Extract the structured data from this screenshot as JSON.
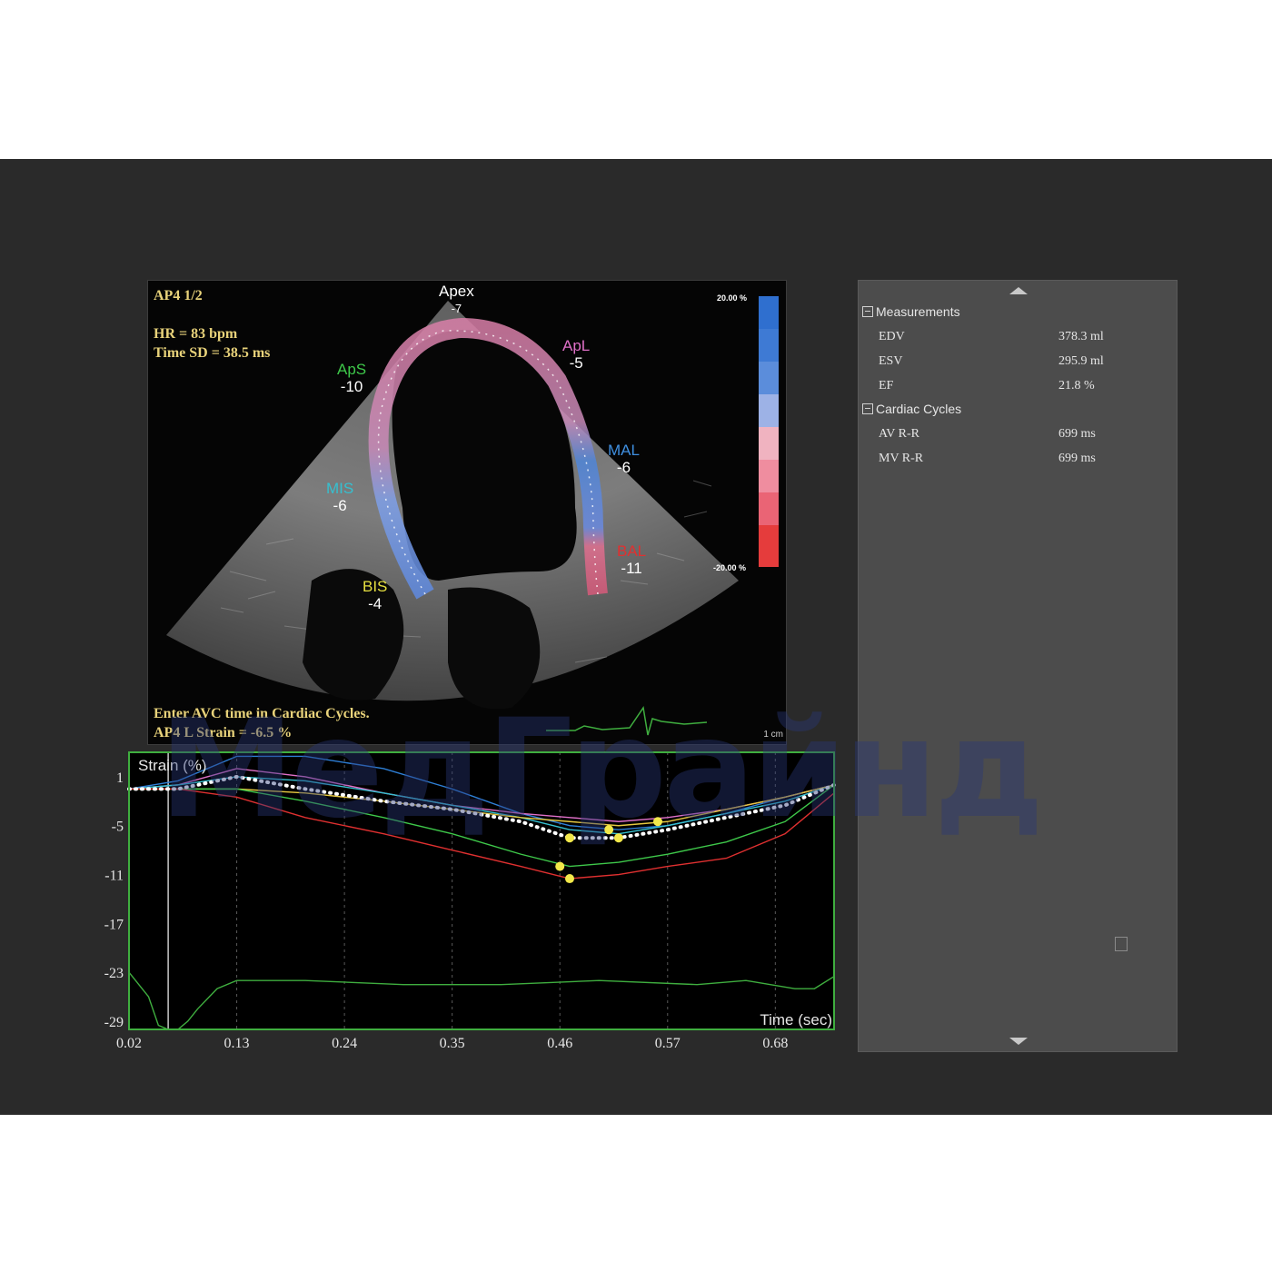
{
  "echo": {
    "view_label": "AP4  1/2",
    "hr": "HR = 83 bpm",
    "time_sd": "Time SD = 38.5 ms",
    "avc_prompt": "Enter AVC time in Cardiac Cycles.",
    "strain_result": "AP4 L Strain = -6.5 %",
    "colorbar_top": "20.00 %",
    "colorbar_bottom": "-20.00 %",
    "scale_label": "1 cm",
    "segments": [
      {
        "name": "Apex",
        "value": "-7",
        "color": "#ffffff"
      },
      {
        "name": "ApL",
        "value": "-5",
        "color": "#e070c8"
      },
      {
        "name": "ApS",
        "value": "-10",
        "color": "#3ec84a"
      },
      {
        "name": "MAL",
        "value": "-6",
        "color": "#3f8fe0"
      },
      {
        "name": "MIS",
        "value": "-6",
        "color": "#35c0d0"
      },
      {
        "name": "BAL",
        "value": "-11",
        "color": "#e03030"
      },
      {
        "name": "BIS",
        "value": "-4",
        "color": "#e6e040"
      }
    ]
  },
  "watermark": "МедГрайнд",
  "measurements": {
    "group1_title": "Measurements",
    "group1_rows": [
      {
        "label": "EDV",
        "value": "378.3 ml"
      },
      {
        "label": "ESV",
        "value": "295.9 ml"
      },
      {
        "label": "EF",
        "value": "21.8 %"
      }
    ],
    "group2_title": "Cardiac Cycles",
    "group2_rows": [
      {
        "label": "AV R-R",
        "value": "699 ms"
      },
      {
        "label": "MV R-R",
        "value": "699 ms"
      }
    ]
  },
  "chart_data": {
    "type": "line",
    "ylabel": "Strain (%)",
    "xlabel": "Time (sec)",
    "x_ticks": [
      "0.02",
      "0.13",
      "0.24",
      "0.35",
      "0.46",
      "0.57",
      "0.68"
    ],
    "y_ticks": [
      "1",
      "-5",
      "-11",
      "-17",
      "-23",
      "-29"
    ],
    "xlim": [
      0.02,
      0.74
    ],
    "ylim": [
      -30,
      4
    ],
    "grid": true,
    "frame_color": "#3fae3f",
    "marker_line_x": 0.06,
    "x": [
      0.02,
      0.07,
      0.13,
      0.2,
      0.28,
      0.35,
      0.42,
      0.47,
      0.52,
      0.57,
      0.63,
      0.69,
      0.74
    ],
    "series": [
      {
        "color": "#2e7fd6",
        "values": [
          -0.5,
          0.5,
          3.5,
          3.5,
          2.0,
          -0.5,
          -3.5,
          -5.0,
          -5.5,
          -5.0,
          -3.5,
          -1.5,
          0.0
        ]
      },
      {
        "color": "#e070c8",
        "values": [
          -0.5,
          0.0,
          2.0,
          1.0,
          -1.0,
          -2.5,
          -3.5,
          -4.0,
          -4.5,
          -4.0,
          -3.0,
          -1.5,
          0.0
        ]
      },
      {
        "color": "#35c0d0",
        "values": [
          -0.5,
          0.0,
          1.0,
          0.5,
          -1.0,
          -2.5,
          -4.0,
          -5.5,
          -6.0,
          -5.0,
          -3.5,
          -2.0,
          0.0
        ]
      },
      {
        "color": "#e6c840",
        "values": [
          -0.5,
          -0.5,
          -0.5,
          -1.0,
          -2.0,
          -3.0,
          -4.0,
          -4.5,
          -5.0,
          -4.5,
          -3.0,
          -1.5,
          0.0
        ]
      },
      {
        "color": "#3ec84a",
        "values": [
          -0.5,
          -0.5,
          -0.5,
          -2.0,
          -4.0,
          -6.0,
          -8.5,
          -10.0,
          -9.5,
          -8.5,
          -7.0,
          -4.5,
          0.0
        ]
      },
      {
        "color": "#e03030",
        "values": [
          -0.5,
          -0.5,
          -1.5,
          -4.0,
          -6.0,
          -8.0,
          -10.0,
          -11.5,
          -11.0,
          -10.0,
          -9.0,
          -6.0,
          -1.0
        ]
      }
    ],
    "average_values": [
      -0.5,
      -0.5,
      1.0,
      -0.5,
      -2.0,
      -3.0,
      -4.5,
      -6.5,
      -6.5,
      -5.5,
      -4.0,
      -2.5,
      0.0
    ],
    "average_color": "#ffffff",
    "ecg": {
      "color": "#3fae3f",
      "x": [
        0.02,
        0.04,
        0.05,
        0.06,
        0.07,
        0.08,
        0.09,
        0.11,
        0.13,
        0.2,
        0.3,
        0.4,
        0.5,
        0.6,
        0.65,
        0.7,
        0.72,
        0.74
      ],
      "values": [
        -23.0,
        -26.0,
        -29.5,
        -30.0,
        -30.0,
        -29.0,
        -27.5,
        -25.0,
        -24.0,
        -24.0,
        -24.5,
        -24.5,
        -24.0,
        -24.5,
        -24.0,
        -25.0,
        -25.0,
        -23.5
      ]
    },
    "markers": [
      {
        "x": 0.46,
        "y": -10.0
      },
      {
        "x": 0.47,
        "y": -11.5
      },
      {
        "x": 0.47,
        "y": -6.5
      },
      {
        "x": 0.51,
        "y": -5.5
      },
      {
        "x": 0.52,
        "y": -6.5
      },
      {
        "x": 0.56,
        "y": -4.5
      }
    ]
  }
}
